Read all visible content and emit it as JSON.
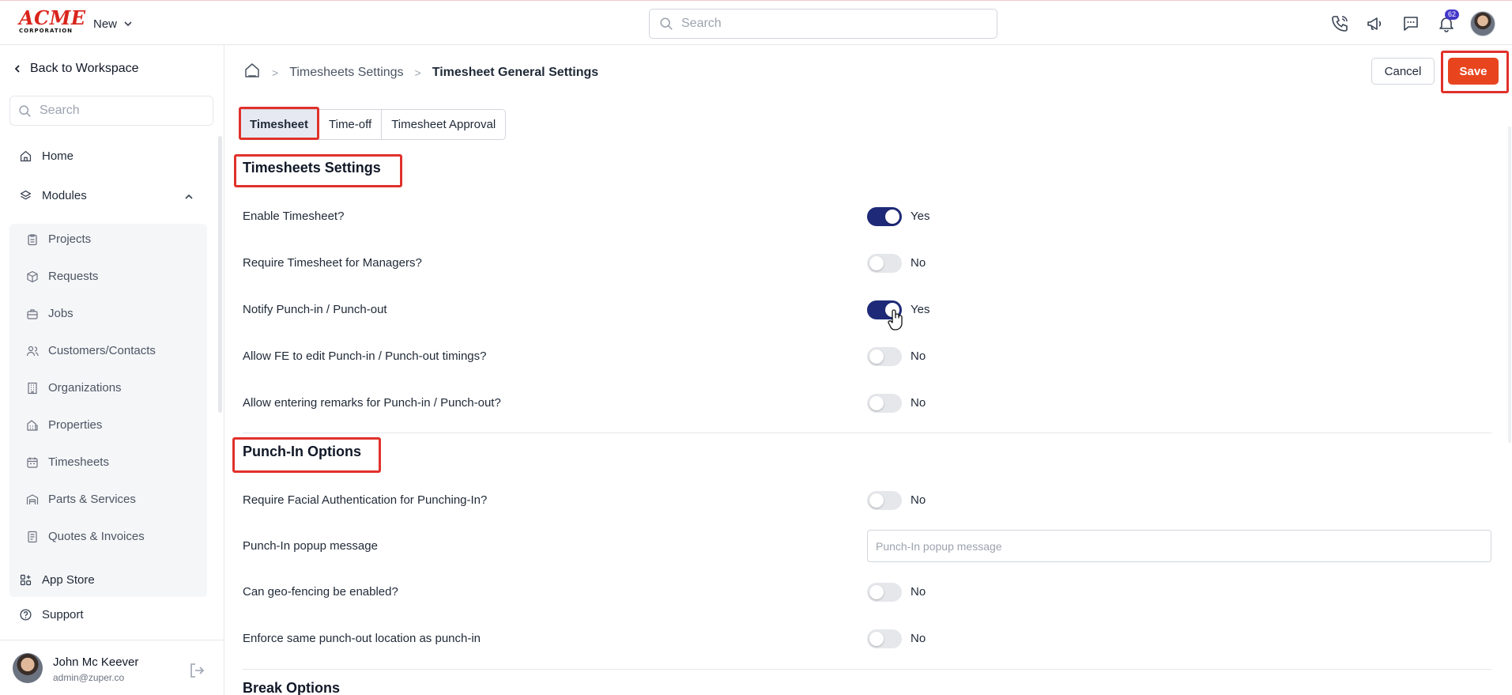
{
  "header": {
    "logo": {
      "main": "ACME",
      "sub": "CORPORATION"
    },
    "new_label": "New",
    "search_placeholder": "Search",
    "notification_count": "62",
    "icons": [
      "phone-icon",
      "megaphone-icon",
      "chat-icon",
      "bell-icon"
    ]
  },
  "sidebar": {
    "back_label": "Back to Workspace",
    "search_placeholder": "Search",
    "home_label": "Home",
    "modules_label": "Modules",
    "modules": [
      {
        "label": "Projects",
        "icon": "clipboard-icon"
      },
      {
        "label": "Requests",
        "icon": "box-icon"
      },
      {
        "label": "Jobs",
        "icon": "briefcase-icon"
      },
      {
        "label": "Customers/Contacts",
        "icon": "users-icon"
      },
      {
        "label": "Organizations",
        "icon": "building-icon"
      },
      {
        "label": "Properties",
        "icon": "property-icon"
      },
      {
        "label": "Timesheets",
        "icon": "calendar-icon"
      },
      {
        "label": "Parts & Services",
        "icon": "warehouse-icon"
      },
      {
        "label": "Quotes & Invoices",
        "icon": "invoice-icon"
      }
    ],
    "app_store_label": "App Store",
    "support_label": "Support",
    "user": {
      "name": "John Mc Keever",
      "email": "admin@zuper.co"
    }
  },
  "breadcrumb": {
    "parent": "Timesheets Settings",
    "current": "Timesheet General Settings"
  },
  "actions": {
    "cancel_label": "Cancel",
    "save_label": "Save"
  },
  "tabs": [
    {
      "label": "Timesheet",
      "active": true
    },
    {
      "label": "Time-off",
      "active": false
    },
    {
      "label": "Timesheet Approval",
      "active": false
    }
  ],
  "timesheet_settings": {
    "title": "Timesheets Settings",
    "rows": [
      {
        "label": "Enable Timesheet?",
        "on": true,
        "value": "Yes"
      },
      {
        "label": "Require Timesheet for Managers?",
        "on": false,
        "value": "No"
      },
      {
        "label": "Notify Punch-in / Punch-out",
        "on": true,
        "value": "Yes"
      },
      {
        "label": "Allow FE to edit Punch-in / Punch-out timings?",
        "on": false,
        "value": "No"
      },
      {
        "label": "Allow entering remarks for Punch-in / Punch-out?",
        "on": false,
        "value": "No"
      }
    ]
  },
  "punch_in_options": {
    "title": "Punch-In Options",
    "facial_auth": {
      "label": "Require Facial Authentication for Punching-In?",
      "on": false,
      "value": "No"
    },
    "popup_message": {
      "label": "Punch-In popup message",
      "placeholder": "Punch-In popup message",
      "value": ""
    },
    "geo_fencing": {
      "label": "Can geo-fencing be enabled?",
      "on": false,
      "value": "No"
    },
    "same_location": {
      "label": "Enforce same punch-out location as punch-in",
      "on": false,
      "value": "No"
    }
  },
  "break_options": {
    "title": "Break Options"
  },
  "colors": {
    "accent": "#1e2a78",
    "save": "#e8451f",
    "highlight": "#e0312b"
  }
}
